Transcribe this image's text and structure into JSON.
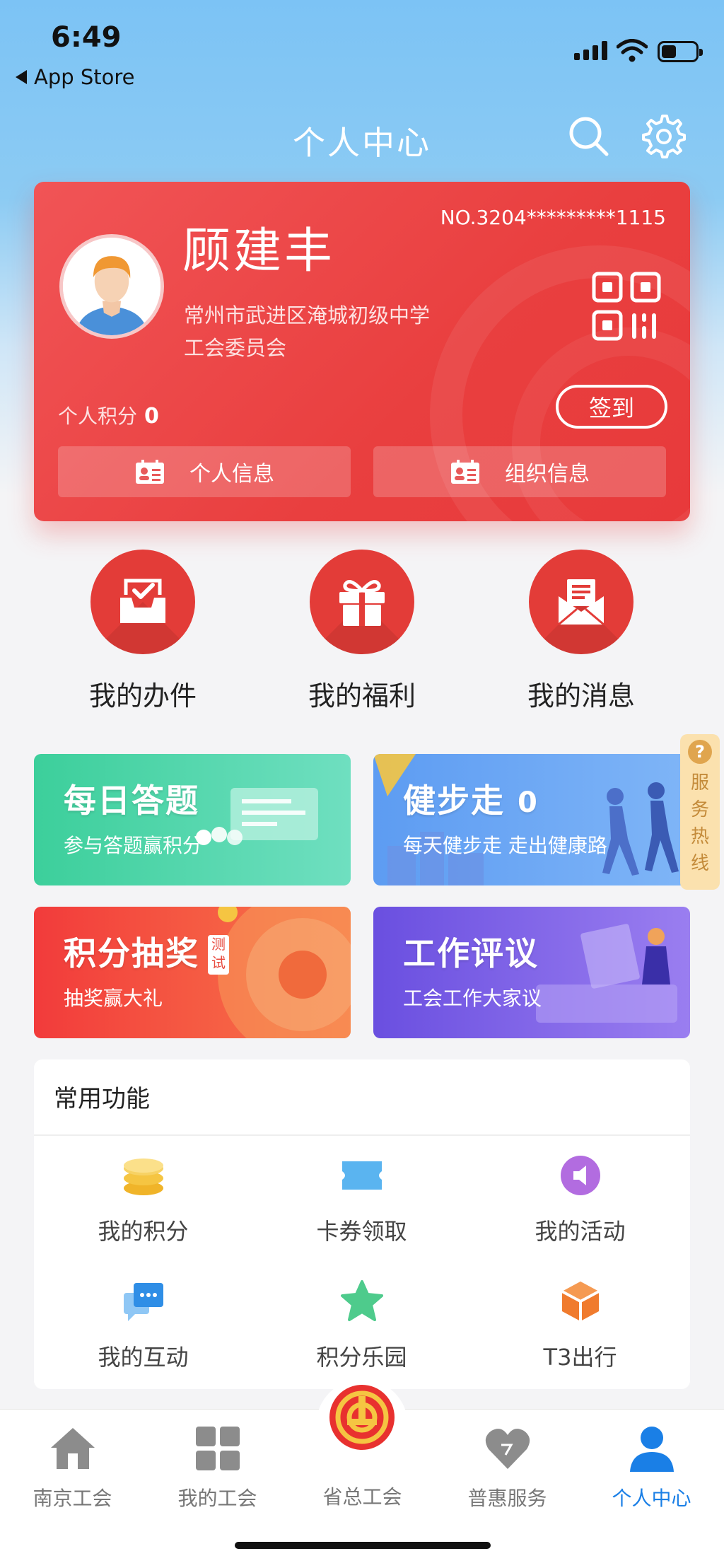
{
  "status_bar": {
    "time": "6:49",
    "back_label": "App Store"
  },
  "header": {
    "title": "个人中心"
  },
  "profile": {
    "name": "顾建丰",
    "member_no": "NO.3204*********1115",
    "org_line1": "常州市武进区淹城初级中学",
    "org_line2": "工会委员会",
    "points_label": "个人积分",
    "points_value": "0",
    "checkin_label": "签到",
    "personal_info_label": "个人信息",
    "org_info_label": "组织信息"
  },
  "quick_actions": [
    {
      "label": "我的办件",
      "icon": "inbox-check-icon"
    },
    {
      "label": "我的福利",
      "icon": "gift-icon"
    },
    {
      "label": "我的消息",
      "icon": "mail-icon"
    }
  ],
  "banners": {
    "quiz": {
      "title": "每日答题",
      "subtitle": "参与答题赢积分",
      "color": "#3fcf9e"
    },
    "steps": {
      "title": "健步走",
      "count": "0",
      "subtitle": "每天健步走 走出健康路",
      "color": "#5b8ef0"
    },
    "lottery": {
      "title": "积分抽奖",
      "tag": "测试",
      "subtitle": "抽奖赢大礼",
      "color": "#f04a3c"
    },
    "review": {
      "title": "工作评议",
      "subtitle": "工会工作大家议",
      "color": "#6d56e0"
    }
  },
  "service_hotline": {
    "label": [
      "服",
      "务",
      "热",
      "线"
    ]
  },
  "features": {
    "title": "常用功能",
    "items": [
      {
        "label": "我的积分",
        "icon": "coin-stack-icon"
      },
      {
        "label": "卡券领取",
        "icon": "ticket-icon"
      },
      {
        "label": "我的活动",
        "icon": "megaphone-icon"
      },
      {
        "label": "我的互动",
        "icon": "chat-icon"
      },
      {
        "label": "积分乐园",
        "icon": "star-icon"
      },
      {
        "label": "T3出行",
        "icon": "t3-icon"
      }
    ]
  },
  "tabbar": {
    "items": [
      {
        "label": "南京工会",
        "icon": "home-icon"
      },
      {
        "label": "我的工会",
        "icon": "grid-icon"
      },
      {
        "label": "省总工会",
        "icon": "union-emblem-icon"
      },
      {
        "label": "普惠服务",
        "icon": "heart-icon"
      },
      {
        "label": "个人中心",
        "icon": "person-icon",
        "active": true
      }
    ]
  },
  "colors": {
    "accent_red": "#e83a3b",
    "tab_active": "#1a7fe6",
    "sky": "#7cc3f5"
  }
}
